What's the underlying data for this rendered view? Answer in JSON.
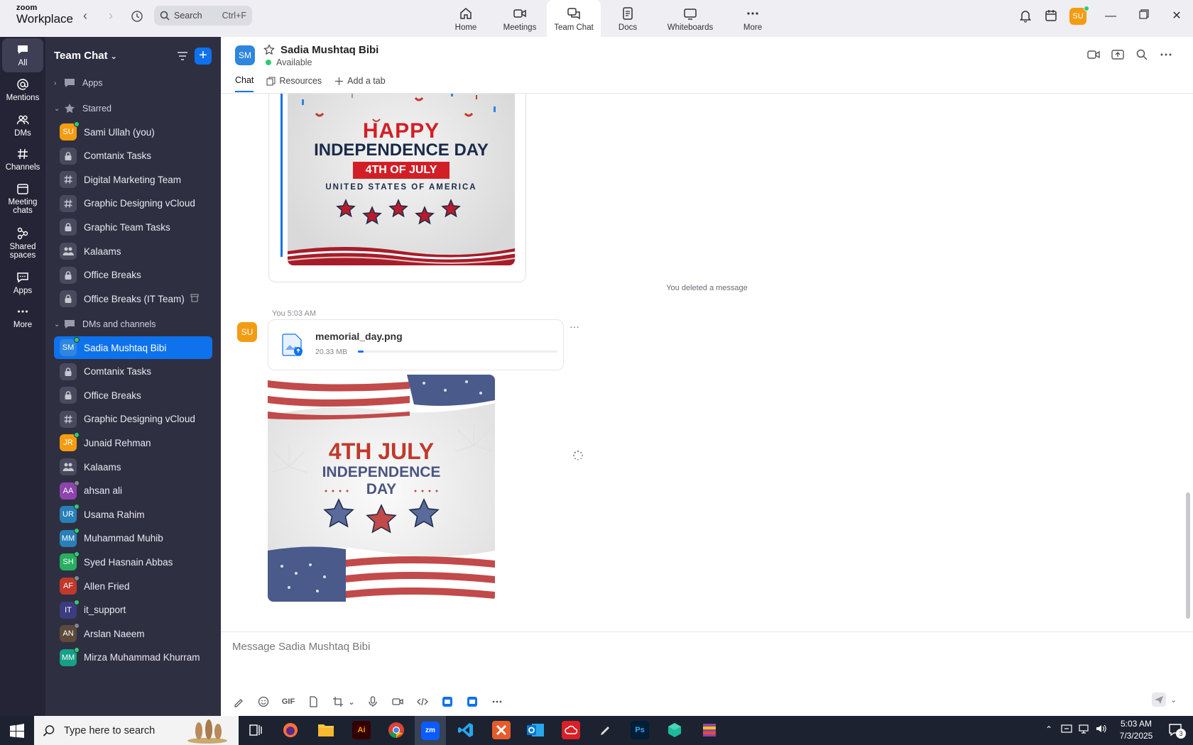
{
  "app": {
    "logo_line1": "zoom",
    "logo_line2": "Workplace",
    "search_placeholder": "Search",
    "search_shortcut": "Ctrl+F",
    "user_initials": "SU"
  },
  "topnav": [
    {
      "label": "Home",
      "icon": "home-icon"
    },
    {
      "label": "Meetings",
      "icon": "video-icon"
    },
    {
      "label": "Team Chat",
      "icon": "chat-icon",
      "active": true
    },
    {
      "label": "Docs",
      "icon": "doc-icon"
    },
    {
      "label": "Whiteboards",
      "icon": "whiteboard-icon"
    },
    {
      "label": "More",
      "icon": "more-icon"
    }
  ],
  "rail": [
    {
      "label": "All",
      "icon": "chat-bubble-icon",
      "active": true
    },
    {
      "label": "Mentions",
      "icon": "at-icon"
    },
    {
      "label": "DMs",
      "icon": "people-icon"
    },
    {
      "label": "Channels",
      "icon": "hash-icon"
    },
    {
      "label": "Meeting chats",
      "line1": "Meeting",
      "line2": "chats",
      "icon": "calendar-icon"
    },
    {
      "label": "Shared spaces",
      "line1": "Shared",
      "line2": "spaces",
      "icon": "shared-spaces-icon"
    },
    {
      "label": "Apps",
      "icon": "apps-icon"
    },
    {
      "label": "More",
      "icon": "more-icon"
    }
  ],
  "sidebar": {
    "title": "Team Chat",
    "sections": {
      "apps": "Apps",
      "starred": "Starred",
      "dms": "DMs and channels"
    },
    "starred": [
      {
        "label": "Sami Ullah (you)",
        "type": "avatar",
        "initials": "SU",
        "color": "#f39c12",
        "presence": "#2ecc71"
      },
      {
        "label": "Comtanix Tasks",
        "type": "lock"
      },
      {
        "label": "Digital Marketing Team",
        "type": "hash"
      },
      {
        "label": "Graphic Designing vCloud",
        "type": "hash"
      },
      {
        "label": "Graphic Team Tasks",
        "type": "lock"
      },
      {
        "label": "Kalaams",
        "type": "group"
      },
      {
        "label": "Office Breaks",
        "type": "lock"
      },
      {
        "label": "Office Breaks (IT Team)",
        "type": "lock",
        "archived": true
      }
    ],
    "dms": [
      {
        "label": "Sadia Mushtaq Bibi",
        "type": "avatar",
        "initials": "SM",
        "color": "#2e86de",
        "presence": "#2ecc71",
        "selected": true
      },
      {
        "label": "Comtanix Tasks",
        "type": "lock"
      },
      {
        "label": "Office Breaks",
        "type": "lock"
      },
      {
        "label": "Graphic Designing vCloud",
        "type": "hash"
      },
      {
        "label": "Junaid Rehman",
        "type": "avatar",
        "initials": "JR",
        "color": "#f39c12",
        "presence": "#2ecc71"
      },
      {
        "label": "Kalaams",
        "type": "group"
      },
      {
        "label": "ahsan ali",
        "type": "avatar",
        "initials": "AA",
        "color": "#8e44ad",
        "presence": "#888"
      },
      {
        "label": "Usama Rahim",
        "type": "avatar",
        "initials": "UR",
        "color": "#2980b9",
        "presence": "#2ecc71"
      },
      {
        "label": "Muhammad Muhib",
        "type": "avatar",
        "initials": "MM",
        "color": "#2980b9",
        "presence": "#2ecc71"
      },
      {
        "label": "Syed Hasnain Abbas",
        "type": "avatar",
        "initials": "SH",
        "color": "#27ae60",
        "presence": "#2ecc71"
      },
      {
        "label": "Allen Fried",
        "type": "avatar",
        "initials": "AF",
        "color": "#c0392b",
        "presence": "#888"
      },
      {
        "label": "it_support",
        "type": "avatar",
        "initials": "IT",
        "color": "#3c3c80",
        "presence": "#2ecc71"
      },
      {
        "label": "Arslan Naeem",
        "type": "avatar",
        "initials": "AN",
        "color": "#5d4a3a",
        "presence": "#888"
      },
      {
        "label": "Mirza Muhammad Khurram",
        "type": "avatar",
        "initials": "MM",
        "color": "#16a085",
        "presence": "#2ecc71"
      }
    ]
  },
  "chat": {
    "initials": "SM",
    "name": "Sadia Mushtaq Bibi",
    "status": "Available",
    "tabs": {
      "chat": "Chat",
      "resources": "Resources",
      "add": "Add a tab"
    },
    "image1": {
      "line1": "HAPPY",
      "line2": "INDEPENDENCE DAY",
      "line3": "4TH OF JULY",
      "line4": "UNITED STATES OF AMERICA"
    },
    "deleted_notice": "You deleted a message",
    "message": {
      "sender_initials": "SU",
      "meta": "You 5:03 AM",
      "file_name": "memorial_day.png",
      "file_size": "20.33 MB",
      "upload_progress": 0.03
    },
    "image2": {
      "line1": "4TH JULY",
      "line2": "INDEPENDENCE",
      "line3": "DAY"
    },
    "composer_placeholder": "Message Sadia Mushtaq Bibi",
    "toolbar_gif": "GIF"
  },
  "taskbar": {
    "search_placeholder": "Type here to search",
    "time": "5:03 AM",
    "date": "7/3/2025",
    "notification_count": "3",
    "zoom_label": "zm",
    "ai_label": "Ai",
    "ps_label": "Ps"
  }
}
